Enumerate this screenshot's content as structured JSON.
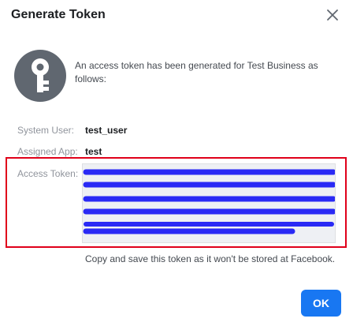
{
  "dialog": {
    "title": "Generate Token",
    "message": "An access token has been generated for Test Business as follows:",
    "system_user": {
      "label": "System User:",
      "value": "test_user"
    },
    "assigned_app": {
      "label": "Assigned App:",
      "value": "test"
    },
    "access_token": {
      "label": "Access Token:",
      "value": ""
    },
    "copy_note": "Copy and save this token as it won't be stored at Facebook.",
    "ok_label": "OK"
  },
  "icons": {
    "close": "close-icon",
    "key": "key-icon"
  },
  "colors": {
    "primary": "#1877f2",
    "highlight": "#e0001a",
    "redaction": "#2a2af5",
    "avatar": "#606770"
  }
}
